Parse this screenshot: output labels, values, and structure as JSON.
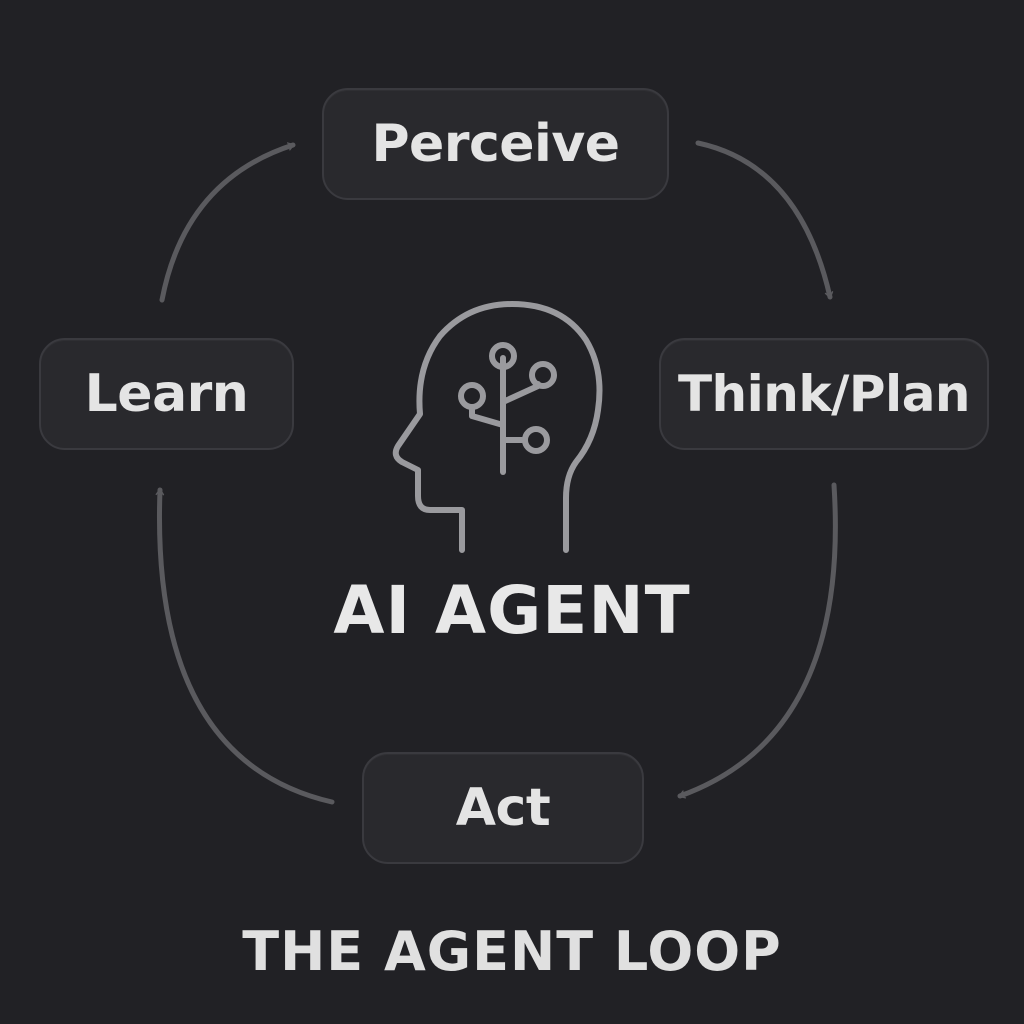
{
  "diagram": {
    "center_label": "AI AGENT",
    "footer_label": "THE AGENT LOOP",
    "steps": {
      "perceive": "Perceive",
      "think_plan": "Think/Plan",
      "act": "Act",
      "learn": "Learn"
    },
    "center_icon": "head-with-circuit-icon",
    "arrow_icon": "curved-arrow-icon",
    "colors": {
      "background": "#212125",
      "node_fill": "#29292d",
      "node_border": "#3a3a3f",
      "arrow": "#5a5a5e",
      "icon_stroke": "#9a9a9e",
      "text": "#e4e4e4"
    }
  }
}
